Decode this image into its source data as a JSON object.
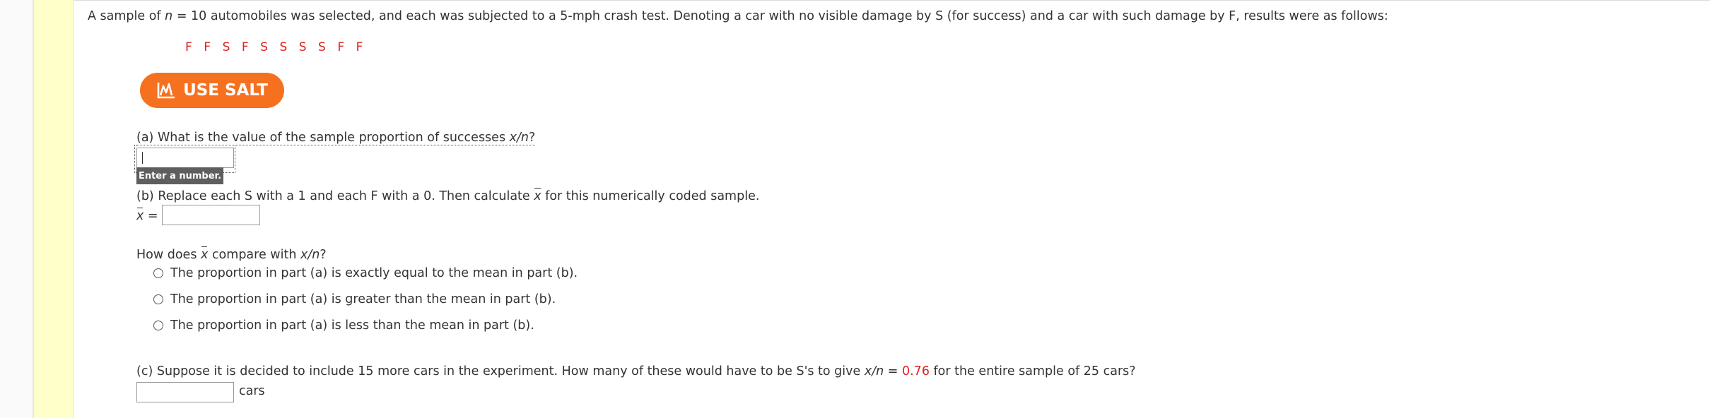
{
  "intro": {
    "part1": "A sample of ",
    "n_var": "n",
    "part2": " = 10 automobiles was selected, and each was subjected to a 5-mph crash test. Denoting a car with no visible damage by S (for success) and a car with such damage by F, results were as follows:"
  },
  "sequence": [
    "F",
    "F",
    "S",
    "F",
    "S",
    "S",
    "S",
    "S",
    "F",
    "F"
  ],
  "salt_button": {
    "label": "USE SALT"
  },
  "part_a": {
    "question": "(a) What is the value of the sample proportion of successes ",
    "expr": "x/n",
    "end": "?",
    "value": "",
    "tooltip": "Enter a number."
  },
  "part_b": {
    "question_pre": "(b) Replace each S with a 1 and each F with a 0. Then calculate ",
    "xbar": "x",
    "question_post": " for this numerically coded sample.",
    "eq": " =",
    "value": ""
  },
  "compare": {
    "pre": "How does ",
    "xbar": "x",
    "mid": " compare with ",
    "expr": "x/n",
    "end": "?",
    "options": [
      "The proportion in part (a) is exactly equal to the mean in part (b).",
      "The proportion in part (a) is greater than the mean in part (b).",
      "The proportion in part (a) is less than the mean in part (b)."
    ]
  },
  "part_c": {
    "pre": "(c) Suppose it is decided to include 15 more cars in the experiment. How many of these would have to be S's to give ",
    "expr": "x/n",
    "eq": " = ",
    "value_highlight": "0.76",
    "post": " for the entire sample of 25 cars?",
    "value": "",
    "unit": "cars"
  },
  "colors": {
    "accent": "#f6711f",
    "highlight": "#e02020",
    "gutter": "#ffffc9"
  },
  "icons": {
    "salt": "chart-line-icon"
  }
}
